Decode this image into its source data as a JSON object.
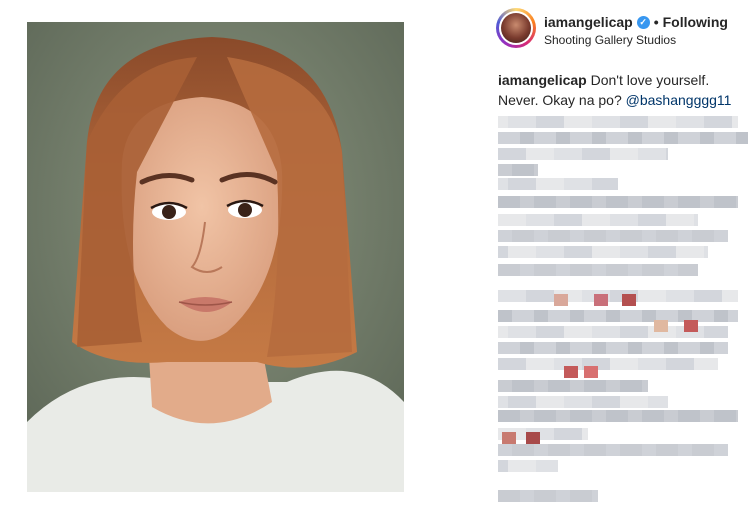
{
  "post": {
    "image_icon": "portrait-photo",
    "header": {
      "username": "iamangelicap",
      "verified_icon": "verified-badge-icon",
      "separator": "•",
      "follow_status": "Following",
      "location": "Shooting Gallery Studios"
    },
    "caption": {
      "username": "iamangelicap",
      "text": "Don't love yourself. Never. Okay na po?",
      "mention": "@bashangggg11"
    }
  },
  "colors": {
    "accent_link": "#003569",
    "verified": "#3897f0",
    "text": "#262626"
  }
}
